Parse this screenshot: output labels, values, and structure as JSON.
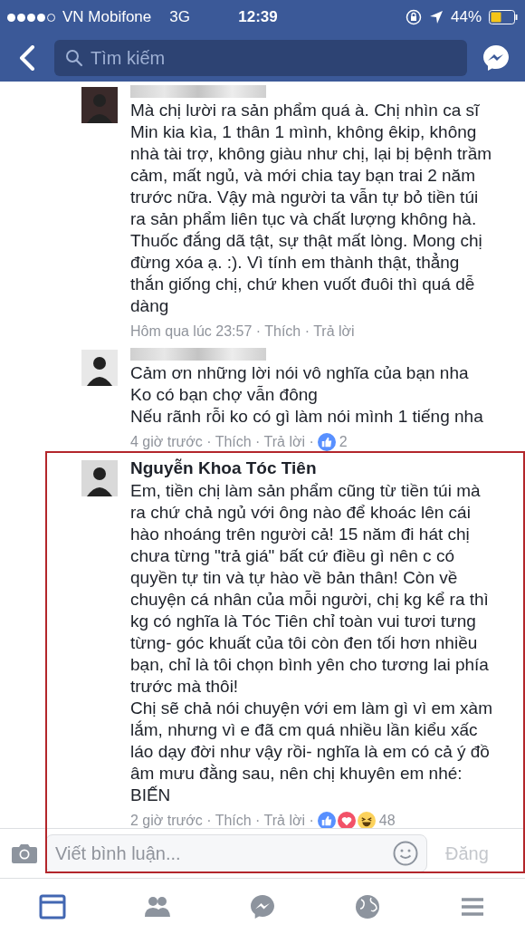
{
  "status_bar": {
    "carrier": "VN Mobifone",
    "network": "3G",
    "time": "12:39",
    "battery": "44%"
  },
  "search": {
    "placeholder": "Tìm kiếm"
  },
  "comments": [
    {
      "paragraphs": [
        "Mà chị lười ra sản phẩm quá à. Chị nhìn ca sĩ Min kia kìa, 1 thân 1 mình, không êkip, không nhà tài trợ, không giàu như chị, lại bị bệnh trầm cảm, mất ngủ, và mới chia tay bạn trai 2 năm trước nữa. Vậy mà người ta vẫn tự bỏ tiền túi ra sản phẩm liên tục và chất lượng không hà.",
        "Thuốc đắng dã tật, sự thật mất lòng. Mong chị đừng xóa ạ. :). Vì tính em thành thật, thẳng thắn giống chị, chứ khen vuốt đuôi thì quá dễ dàng"
      ],
      "meta": "Hôm qua lúc 23:57 · Thích · Trả lời",
      "highlighted": false
    },
    {
      "paragraphs": [
        "Cảm ơn những lời nói vô nghĩa của bạn nha",
        "Ko có bạn chợ vẫn đông",
        "Nếu rãnh rỗi ko có gì làm nói mình 1 tiếng nha"
      ],
      "meta": "4 giờ trước · Thích · Trả lời ·",
      "reactions": [
        {
          "kind": "like"
        }
      ],
      "reaction_count": "2",
      "highlighted": false
    },
    {
      "author": "Nguyễn Khoa Tóc Tiên",
      "paragraphs": [
        "Em, tiền chị làm sản phẩm cũng từ tiền túi mà ra chứ chả ngủ với ông nào để khoác lên cái hào nhoáng trên người cả! 15 năm đi hát chị chưa từng \"trả giá\" bất cứ điều gì nên c có quyền tự tin và tự hào về bản thân! Còn về chuyện cá nhân của mỗi người, chị kg kể ra thì kg có nghĩa là Tóc Tiên chỉ toàn vui tươi tưng từng- góc khuất của tôi còn đen tối hơn nhiều bạn, chỉ là tôi chọn bình yên cho tương lai phía trước mà thôi!",
        "Chị sẽ chả nói chuyện với em làm gì vì em xàm lắm, nhưng vì e đã cm quá nhiều lần kiểu xấc láo dạy đời như vậy rồi- nghĩa là em có cả ý đồ âm mưu đằng sau, nên chị khuyên em nhé:",
        "BIẾN"
      ],
      "meta": "2 giờ trước · Thích · Trả lời ·",
      "reactions": [
        {
          "kind": "like"
        },
        {
          "kind": "love"
        },
        {
          "kind": "haha"
        }
      ],
      "reaction_count": "48",
      "highlighted": true
    }
  ],
  "composer": {
    "placeholder": "Viết bình luận...",
    "post_button": "Đăng",
    "post_disabled": true
  },
  "tab_bar": [
    {
      "kind": "feed",
      "selected": true
    },
    {
      "kind": "friends",
      "selected": false
    },
    {
      "kind": "messenger",
      "selected": false
    },
    {
      "kind": "globe",
      "selected": false
    },
    {
      "kind": "menu",
      "selected": false
    }
  ]
}
